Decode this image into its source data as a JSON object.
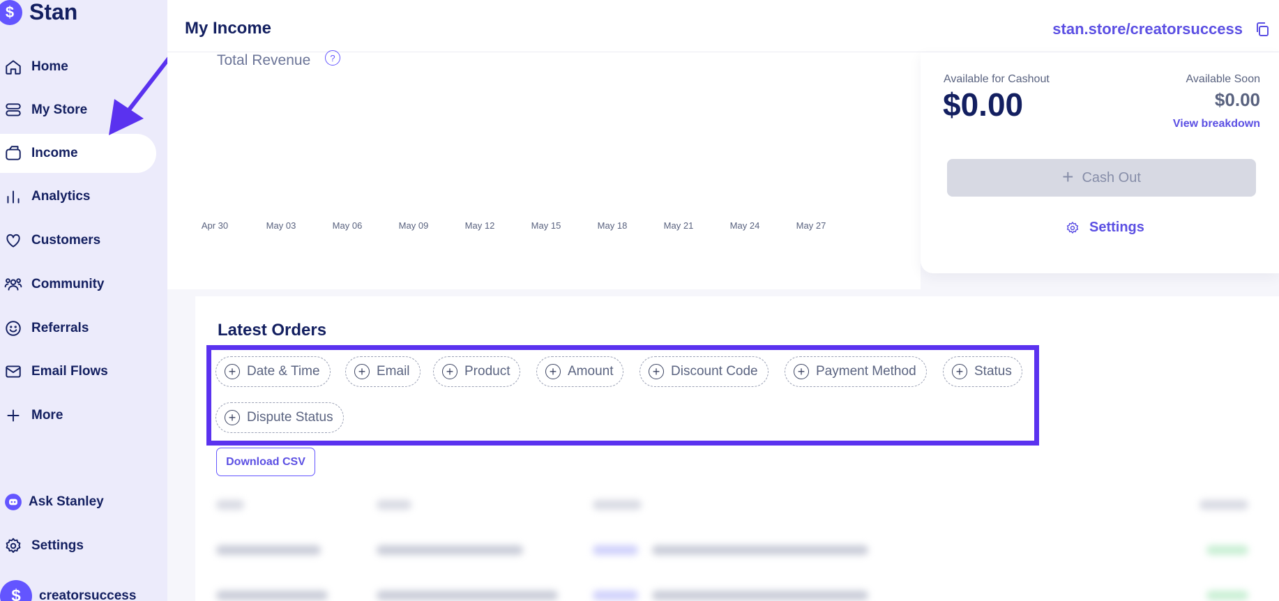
{
  "brand": {
    "logo_glyph": "$",
    "name": "Stan"
  },
  "sidebar": {
    "items": [
      {
        "label": "Home",
        "icon": "home-icon"
      },
      {
        "label": "My Store",
        "icon": "store-icon"
      },
      {
        "label": "Income",
        "icon": "wallet-icon",
        "active": true
      },
      {
        "label": "Analytics",
        "icon": "bar-chart-icon"
      },
      {
        "label": "Customers",
        "icon": "heart-icon"
      },
      {
        "label": "Community",
        "icon": "users-icon"
      },
      {
        "label": "Referrals",
        "icon": "smile-icon"
      },
      {
        "label": "Email Flows",
        "icon": "mail-icon"
      },
      {
        "label": "More",
        "icon": "plus-icon"
      }
    ],
    "bottom": [
      {
        "label": "Ask Stanley",
        "icon": "robot-icon"
      },
      {
        "label": "Settings",
        "icon": "gear-icon"
      }
    ],
    "user": {
      "avatar_glyph": "$",
      "name": "creatorsuccess"
    }
  },
  "header": {
    "title": "My Income",
    "store_link": "stan.store/creatorsuccess"
  },
  "revenue": {
    "title": "Total Revenue",
    "help_glyph": "?"
  },
  "chart_data": {
    "type": "line",
    "title": "Total Revenue",
    "x": [
      "Apr 30",
      "May 03",
      "May 06",
      "May 09",
      "May 12",
      "May 15",
      "May 18",
      "May 21",
      "May 24",
      "May 27"
    ],
    "series": [],
    "grid": false
  },
  "cashout": {
    "available_label": "Available for Cashout",
    "available_amount": "$0.00",
    "soon_label": "Available Soon",
    "soon_amount": "$0.00",
    "breakdown_label": "View breakdown",
    "button_label": "Cash Out",
    "settings_label": "Settings"
  },
  "orders": {
    "title": "Latest Orders",
    "filters": [
      "Date & Time",
      "Email",
      "Product",
      "Amount",
      "Discount Code",
      "Payment Method",
      "Status",
      "Dispute Status"
    ],
    "download_label": "Download CSV"
  },
  "colors": {
    "accent": "#6355ff",
    "highlight": "#5a32ef",
    "sidebar_bg": "#ecebfb",
    "text_dark": "#131f60"
  }
}
